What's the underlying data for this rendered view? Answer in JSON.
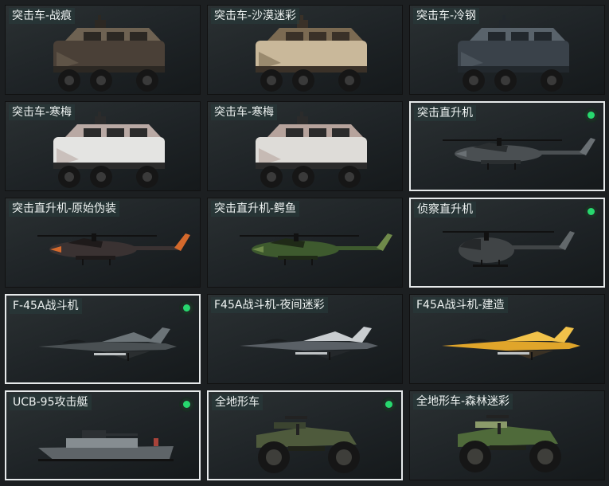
{
  "cards": [
    {
      "label": "突击车-战痕",
      "vehicle": "armored-car-icon",
      "owned": false,
      "selected": false,
      "colors": [
        "#4a4037",
        "#6e6252",
        "#2c2823"
      ]
    },
    {
      "label": "突击车-沙漠迷彩",
      "vehicle": "armored-car-icon",
      "owned": false,
      "selected": false,
      "colors": [
        "#c9b89a",
        "#7b6a52",
        "#3a3128"
      ]
    },
    {
      "label": "突击车-冷钢",
      "vehicle": "armored-car-icon",
      "owned": false,
      "selected": false,
      "colors": [
        "#3a424a",
        "#59636b",
        "#22282d"
      ]
    },
    {
      "label": "突击车-寒梅",
      "vehicle": "armored-car-icon",
      "owned": false,
      "selected": false,
      "colors": [
        "#e4e4e2",
        "#b9a9a4",
        "#2b2b2b"
      ]
    },
    {
      "label": "突击车-寒梅",
      "vehicle": "armored-car-icon",
      "owned": false,
      "selected": false,
      "colors": [
        "#dedcd8",
        "#b6a39c",
        "#2b2b2b"
      ]
    },
    {
      "label": "突击直升机",
      "vehicle": "attack-helicopter-icon",
      "owned": true,
      "selected": true,
      "colors": [
        "#4a4f52",
        "#6a7074",
        "#2a2e30"
      ]
    },
    {
      "label": "突击直升机-原始伪装",
      "vehicle": "attack-helicopter-icon",
      "owned": false,
      "selected": false,
      "colors": [
        "#3a3232",
        "#d4692c",
        "#1e1a1a"
      ]
    },
    {
      "label": "突击直升机-鳄鱼",
      "vehicle": "attack-helicopter-icon",
      "owned": false,
      "selected": false,
      "colors": [
        "#3e5a2e",
        "#6f8a4a",
        "#1f2a17"
      ]
    },
    {
      "label": "侦察直升机",
      "vehicle": "scout-helicopter-icon",
      "owned": true,
      "selected": true,
      "colors": [
        "#404446",
        "#62686b",
        "#25282a"
      ]
    },
    {
      "label": "F-45A战斗机",
      "vehicle": "fighter-jet-icon",
      "owned": true,
      "selected": true,
      "colors": [
        "#4a5053",
        "#6c7478",
        "#2a2e30"
      ]
    },
    {
      "label": "F45A战斗机-夜间迷彩",
      "vehicle": "fighter-jet-icon",
      "owned": false,
      "selected": false,
      "colors": [
        "#5a6066",
        "#c9cdd0",
        "#24282b"
      ]
    },
    {
      "label": "F45A战斗机-建造",
      "vehicle": "fighter-jet-icon",
      "owned": false,
      "selected": false,
      "colors": [
        "#e0a52a",
        "#f1c24a",
        "#3a3124"
      ]
    },
    {
      "label": "UCB-95攻击艇",
      "vehicle": "attack-boat-icon",
      "owned": true,
      "selected": true,
      "colors": [
        "#5e6468",
        "#868d91",
        "#2c3033"
      ]
    },
    {
      "label": "全地形车",
      "vehicle": "atv-icon",
      "owned": true,
      "selected": true,
      "colors": [
        "#4e5a3c",
        "#3b4430",
        "#1f2219"
      ]
    },
    {
      "label": "全地形车-森林迷彩",
      "vehicle": "atv-icon",
      "owned": false,
      "selected": false,
      "colors": [
        "#4f6a3a",
        "#8a9a6a",
        "#1f2219"
      ]
    }
  ]
}
